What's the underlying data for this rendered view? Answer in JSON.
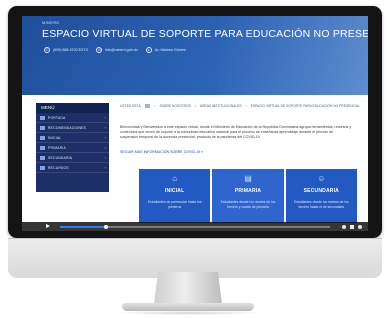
{
  "header": {
    "ministry": "MINERD",
    "title": "ESPACIO VIRTUAL DE SOPORTE PARA EDUCACIÓN NO PRESENCIAL",
    "contacts": [
      {
        "icon": "phone-icon",
        "text": "(809) 688-9700 EXT.0"
      },
      {
        "icon": "email-icon",
        "text": "info@minerd.gob.do"
      },
      {
        "icon": "location-icon",
        "text": "Av. Máximo Gómez"
      }
    ]
  },
  "sidebar": {
    "title": "MENÚ",
    "items": [
      {
        "label": "PORTADA"
      },
      {
        "label": "RECOMENDACIONES"
      },
      {
        "label": "INICIAL"
      },
      {
        "label": "PRIMARIA"
      },
      {
        "label": "SECUNDARIA"
      },
      {
        "label": "RECURSOS"
      }
    ]
  },
  "breadcrumb": {
    "items": [
      "USTED ESTÁ",
      "SOBRE NOSOTROS",
      "ÁREAS INSTITUCIONALES",
      "ESPACIO VIRTUAL DE SOPORTE PARA EDUCACIÓN NO PRESENCIAL"
    ]
  },
  "main": {
    "intro": "Bienvenidas y Bienvenidos a este espacio virtual, donde el Ministerio de Educación de la República Dominicana agrupa herramientas, recursos y contenidos que sirven de soporte a la comunidad educativa nacional para el proceso de enseñanza aprendizaje durante el período de suspensión temporal de la docencia presencial, producto de la pandemia del COVID-19.",
    "link": "SEGUIR MÁS INFORMACIÓN SOBRE COVID-19  »"
  },
  "cards": [
    {
      "title": "INICIAL",
      "desc": "Estudiantes de preescolar hasta los primeros",
      "icon": "school-icon"
    },
    {
      "title": "PRIMARIA",
      "desc": "Estudiantes desde los niveles de los tercero y cuarto de primaria",
      "icon": "book-icon"
    },
    {
      "title": "SECUNDARIA",
      "desc": "Estudiantes desde los niveles de los tercero hasta el de secundaria",
      "icon": "students-icon"
    }
  ],
  "player": {
    "progress": 0.17
  },
  "colors": {
    "banner": "#2b63b5",
    "sidebar": "#1c2f66",
    "card": "#2259c2",
    "link": "#1c4aa8"
  }
}
